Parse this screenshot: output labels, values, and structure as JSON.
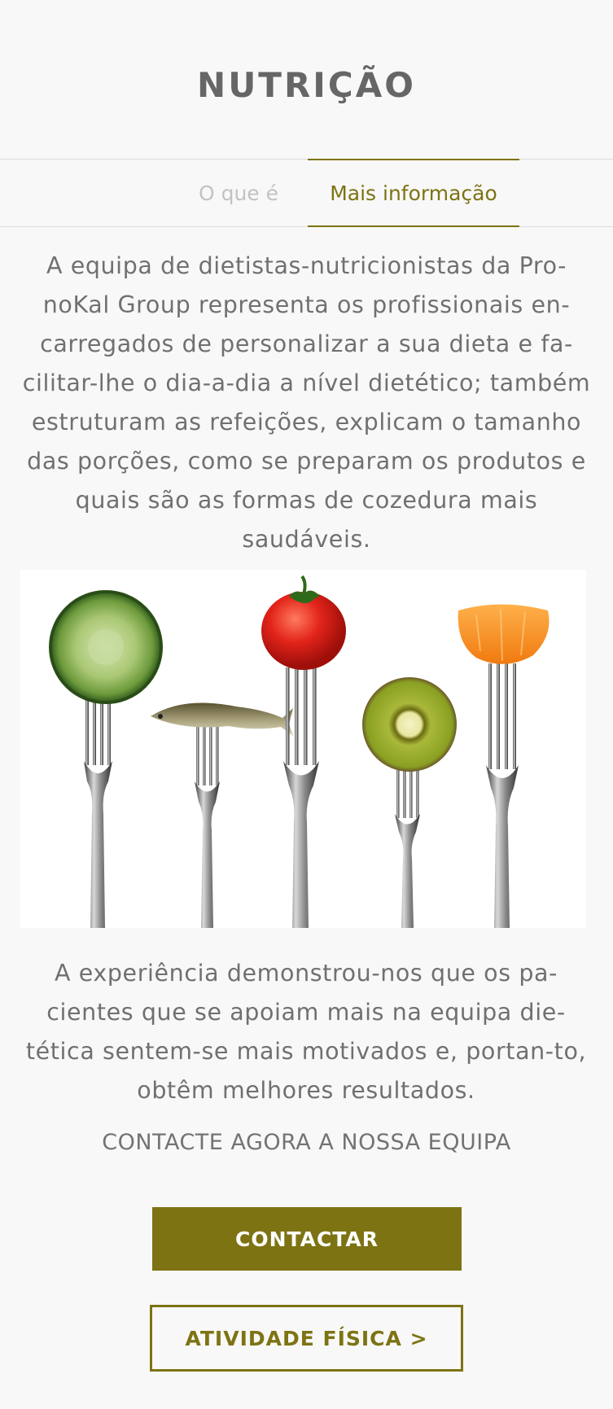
{
  "header": {
    "title": "NUTRIÇÃO"
  },
  "tabs": [
    {
      "label": "O que é",
      "active": false
    },
    {
      "label": "Mais informação",
      "active": true
    }
  ],
  "content": {
    "intro": "A equipa de dietistas-nutricionistas da Pro-noKal Group representa os profissionais en-carregados de personalizar a sua dieta e fa-cilitar-lhe o dia-a-dia a nível dietético; também estruturam as refeições, explicam o tamanho das porções, como se preparam os produtos e quais são as formas de cozedura mais saudáveis.",
    "outro": "A experiência demonstrou-nos que os pa-cientes que se apoiam mais na equipa die-tética sentem-se mais motivados e, portan-to, obtêm melhores resultados.",
    "cta_text": "CONTACTE AGORA A NOSSA EQUIPA"
  },
  "image": {
    "subject": "forks-with-food-photo"
  },
  "buttons": {
    "contact": "CONTACTAR",
    "activity": "ATIVIDADE FÍSICA >"
  },
  "colors": {
    "accent": "#7d7313",
    "background": "#f8f8f8",
    "text": "#707070",
    "inactive_tab": "#c2c2c2"
  }
}
